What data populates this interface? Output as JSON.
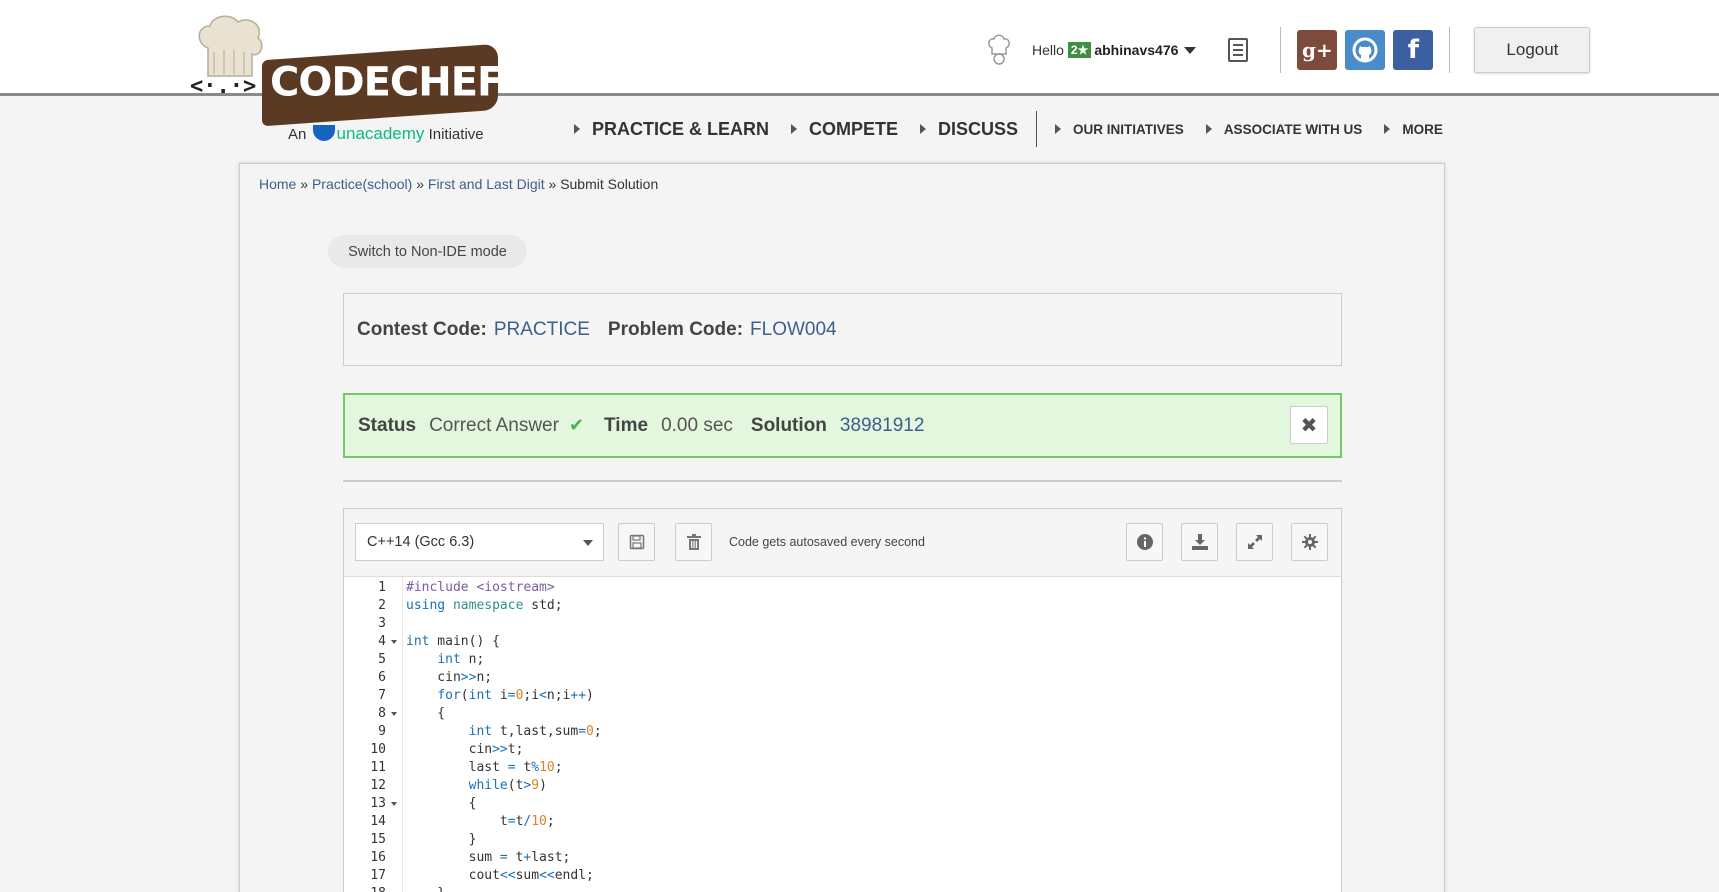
{
  "header": {
    "logo_text": "CODECHEF",
    "tagline_prefix": "An",
    "tagline_brand": "unacademy",
    "tagline_suffix": "Initiative",
    "greeting": "Hello",
    "user_stars": "2★",
    "username": "abhinavs476",
    "logout_label": "Logout"
  },
  "nav": {
    "items": [
      {
        "label": "PRACTICE & LEARN"
      },
      {
        "label": "COMPETE"
      },
      {
        "label": "DISCUSS"
      },
      {
        "label": "OUR INITIATIVES"
      },
      {
        "label": "ASSOCIATE WITH US"
      },
      {
        "label": "MORE"
      }
    ]
  },
  "breadcrumb": {
    "home": "Home",
    "sep": "»",
    "practice": "Practice(school)",
    "problem": "First and Last Digit",
    "current": "Submit Solution"
  },
  "switch_mode_label": "Switch to Non-IDE mode",
  "problem_info": {
    "contest_label": "Contest Code:",
    "contest_value": "PRACTICE",
    "problem_label": "Problem Code:",
    "problem_value": "FLOW004"
  },
  "status": {
    "status_label": "Status",
    "status_value": "Correct Answer",
    "time_label": "Time",
    "time_value": "0.00 sec",
    "solution_label": "Solution",
    "solution_value": "38981912",
    "success_color": "#6fcb63"
  },
  "editor": {
    "language": "C++14 (Gcc 6.3)",
    "autosave_text": "Code gets autosaved every second",
    "code_lines": [
      "#include <iostream>",
      "using namespace std;",
      "",
      "int main() {",
      "    int n;",
      "    cin>>n;",
      "    for(int i=0;i<n;i++)",
      "    {",
      "        int t,last,sum=0;",
      "        cin>>t;",
      "        last = t%10;",
      "        while(t>9)",
      "        {",
      "            t=t/10;",
      "        }",
      "        sum = t+last;",
      "        cout<<sum<<endl;",
      "    }"
    ],
    "fold_lines": [
      4,
      8,
      13
    ]
  },
  "colors": {
    "link": "#3e5f8a",
    "brand_brown": "#5b3a24",
    "google": "#7d4a3c",
    "github": "#4a8cca",
    "facebook": "#3b5fa0"
  }
}
